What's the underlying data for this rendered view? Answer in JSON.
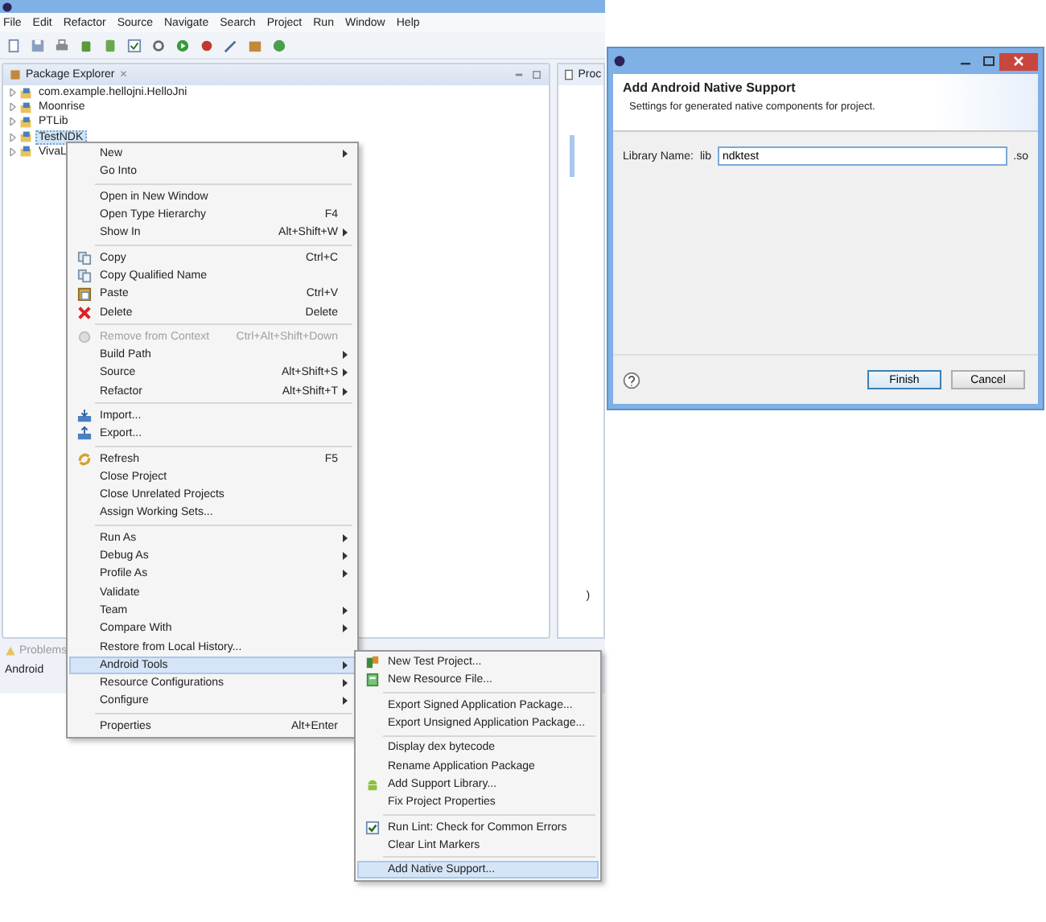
{
  "menubar": [
    "File",
    "Edit",
    "Refactor",
    "Source",
    "Navigate",
    "Search",
    "Project",
    "Run",
    "Window",
    "Help"
  ],
  "package_explorer": {
    "title": "Package Explorer",
    "close": "✕",
    "items": [
      {
        "label": "com.example.hellojni.HelloJni",
        "selected": false,
        "expanded": false
      },
      {
        "label": "Moonrise",
        "selected": false,
        "expanded": false
      },
      {
        "label": "PTLib",
        "selected": false,
        "expanded": false
      },
      {
        "label": "TestNDK",
        "selected": true,
        "expanded": false
      },
      {
        "label": "VivaL",
        "selected": false,
        "expanded": false
      }
    ]
  },
  "right_panel": {
    "tab": "Proc",
    "fragment": ")"
  },
  "bottom_panel": {
    "tab": "Problems",
    "row": "Android"
  },
  "context_menu": [
    {
      "kind": "item",
      "label": "New",
      "submenu": true,
      "disabled": false,
      "selected": false
    },
    {
      "kind": "item",
      "label": "Go Into",
      "submenu": false,
      "disabled": false,
      "selected": false
    },
    {
      "kind": "separator"
    },
    {
      "kind": "item",
      "label": "Open in New Window",
      "submenu": false,
      "disabled": false,
      "selected": false
    },
    {
      "kind": "item",
      "label": "Open Type Hierarchy",
      "shortcut": "F4",
      "submenu": false,
      "disabled": false,
      "selected": false
    },
    {
      "kind": "item",
      "label": "Show In",
      "shortcut": "Alt+Shift+W",
      "submenu": true,
      "disabled": false,
      "selected": false
    },
    {
      "kind": "separator"
    },
    {
      "kind": "item",
      "label": "Copy",
      "shortcut": "Ctrl+C",
      "submenu": false,
      "disabled": false,
      "selected": false
    },
    {
      "kind": "item",
      "label": "Copy Qualified Name",
      "submenu": false,
      "disabled": false,
      "selected": false
    },
    {
      "kind": "item",
      "label": "Paste",
      "shortcut": "Ctrl+V",
      "submenu": false,
      "disabled": false,
      "selected": false
    },
    {
      "kind": "item",
      "label": "Delete",
      "shortcut": "Delete",
      "submenu": false,
      "disabled": false,
      "selected": false
    },
    {
      "kind": "separator"
    },
    {
      "kind": "item",
      "label": "Remove from Context",
      "shortcut": "Ctrl+Alt+Shift+Down",
      "submenu": false,
      "disabled": true,
      "selected": false
    },
    {
      "kind": "item",
      "label": "Build Path",
      "submenu": true,
      "disabled": false,
      "selected": false
    },
    {
      "kind": "item",
      "label": "Source",
      "shortcut": "Alt+Shift+S",
      "submenu": true,
      "disabled": false,
      "selected": false
    },
    {
      "kind": "item",
      "label": "Refactor",
      "shortcut": "Alt+Shift+T",
      "submenu": true,
      "disabled": false,
      "selected": false
    },
    {
      "kind": "separator"
    },
    {
      "kind": "item",
      "label": "Import...",
      "submenu": false,
      "disabled": false,
      "selected": false
    },
    {
      "kind": "item",
      "label": "Export...",
      "submenu": false,
      "disabled": false,
      "selected": false
    },
    {
      "kind": "separator"
    },
    {
      "kind": "item",
      "label": "Refresh",
      "shortcut": "F5",
      "submenu": false,
      "disabled": false,
      "selected": false
    },
    {
      "kind": "item",
      "label": "Close Project",
      "submenu": false,
      "disabled": false,
      "selected": false
    },
    {
      "kind": "item",
      "label": "Close Unrelated Projects",
      "submenu": false,
      "disabled": false,
      "selected": false
    },
    {
      "kind": "item",
      "label": "Assign Working Sets...",
      "submenu": false,
      "disabled": false,
      "selected": false
    },
    {
      "kind": "separator"
    },
    {
      "kind": "item",
      "label": "Run As",
      "submenu": true,
      "disabled": false,
      "selected": false
    },
    {
      "kind": "item",
      "label": "Debug As",
      "submenu": true,
      "disabled": false,
      "selected": false
    },
    {
      "kind": "item",
      "label": "Profile As",
      "submenu": true,
      "disabled": false,
      "selected": false
    },
    {
      "kind": "item",
      "label": "Validate",
      "submenu": false,
      "disabled": false,
      "selected": false
    },
    {
      "kind": "item",
      "label": "Team",
      "submenu": true,
      "disabled": false,
      "selected": false
    },
    {
      "kind": "item",
      "label": "Compare With",
      "submenu": true,
      "disabled": false,
      "selected": false
    },
    {
      "kind": "item",
      "label": "Restore from Local History...",
      "submenu": false,
      "disabled": false,
      "selected": false
    },
    {
      "kind": "item",
      "label": "Android Tools",
      "submenu": true,
      "disabled": false,
      "selected": true
    },
    {
      "kind": "item",
      "label": "Resource Configurations",
      "submenu": true,
      "disabled": false,
      "selected": false
    },
    {
      "kind": "item",
      "label": "Configure",
      "submenu": true,
      "disabled": false,
      "selected": false
    },
    {
      "kind": "separator"
    },
    {
      "kind": "item",
      "label": "Properties",
      "shortcut": "Alt+Enter",
      "submenu": false,
      "disabled": false,
      "selected": false
    }
  ],
  "submenu": [
    {
      "kind": "item",
      "label": "New Test Project...",
      "submenu": false,
      "disabled": false,
      "selected": false
    },
    {
      "kind": "item",
      "label": "New Resource File...",
      "submenu": false,
      "disabled": false,
      "selected": false
    },
    {
      "kind": "separator"
    },
    {
      "kind": "item",
      "label": "Export Signed Application Package...",
      "submenu": false,
      "disabled": false,
      "selected": false
    },
    {
      "kind": "item",
      "label": "Export Unsigned Application Package...",
      "submenu": false,
      "disabled": false,
      "selected": false
    },
    {
      "kind": "separator"
    },
    {
      "kind": "item",
      "label": "Display dex bytecode",
      "submenu": false,
      "disabled": false,
      "selected": false
    },
    {
      "kind": "item",
      "label": "Rename Application Package",
      "submenu": false,
      "disabled": false,
      "selected": false
    },
    {
      "kind": "item",
      "label": "Add Support Library...",
      "submenu": false,
      "disabled": false,
      "selected": false
    },
    {
      "kind": "item",
      "label": "Fix Project Properties",
      "submenu": false,
      "disabled": false,
      "selected": false
    },
    {
      "kind": "separator"
    },
    {
      "kind": "item",
      "label": "Run Lint: Check for Common Errors",
      "submenu": false,
      "disabled": false,
      "selected": false
    },
    {
      "kind": "item",
      "label": "Clear Lint Markers",
      "submenu": false,
      "disabled": false,
      "selected": false
    },
    {
      "kind": "separator"
    },
    {
      "kind": "item",
      "label": "Add Native Support...",
      "submenu": false,
      "disabled": false,
      "selected": true
    }
  ],
  "dialog": {
    "title": "Add Android Native Support",
    "subtitle": "Settings for generated native components for project.",
    "field_label": "Library Name:",
    "prefix": "lib",
    "value": "ndktest",
    "suffix": ".so",
    "buttons": [
      {
        "label": "Finish",
        "selected": true
      },
      {
        "label": "Cancel",
        "selected": false
      }
    ]
  }
}
